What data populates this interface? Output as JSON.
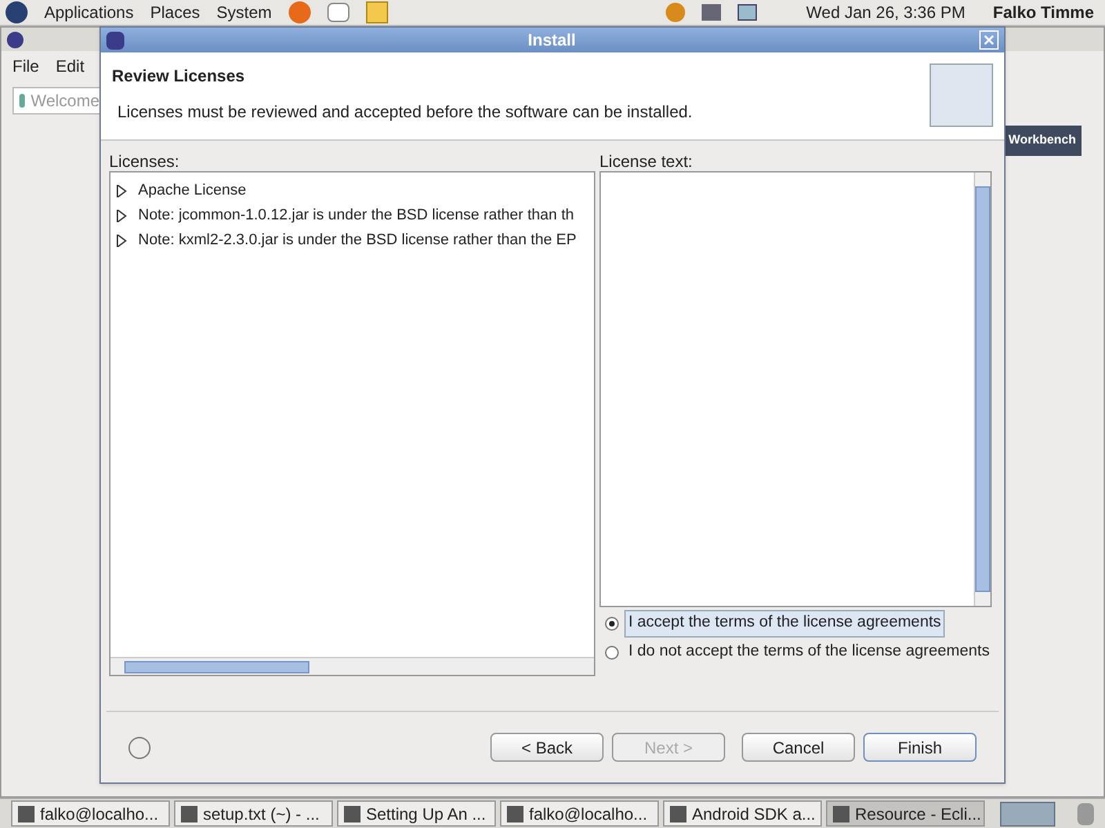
{
  "top_panel": {
    "menus": [
      "Applications",
      "Places",
      "System"
    ],
    "clock": "Wed Jan 26,  3:36 PM",
    "user": "Falko Timme"
  },
  "background_window": {
    "menus": [
      "File",
      "Edit"
    ],
    "tab": "Welcome",
    "workbench_label": "Workbench"
  },
  "dialog": {
    "title": "Install",
    "heading": "Review Licenses",
    "description": "Licenses must be reviewed and accepted before the software can be installed.",
    "licenses_label": "Licenses:",
    "license_text_label": "License text:",
    "licenses": [
      {
        "label": "Apache License",
        "expanded": false
      },
      {
        "label": "Note:  jcommon-1.0.12.jar is under the BSD license rather than th",
        "expanded": false
      },
      {
        "label": "Note:  kxml2-2.3.0.jar is under the BSD license rather than the EP",
        "expanded": false
      }
    ],
    "options": [
      {
        "label": "I accept the terms of the license agreements",
        "selected": true
      },
      {
        "label": "I do not accept the terms of the license agreements",
        "selected": false
      }
    ],
    "buttons": [
      {
        "label": "< Back",
        "disabled": false,
        "default": false
      },
      {
        "label": "Next >",
        "disabled": true,
        "default": false
      },
      {
        "label": "Cancel",
        "disabled": false,
        "default": false
      },
      {
        "label": "Finish",
        "disabled": false,
        "default": true
      }
    ]
  },
  "taskbar": [
    {
      "label": "falko@localho...",
      "selected": false
    },
    {
      "label": "setup.txt (~) - ...",
      "selected": false
    },
    {
      "label": "Setting Up An ...",
      "selected": false
    },
    {
      "label": "falko@localho...",
      "selected": false
    },
    {
      "label": "Android SDK a...",
      "selected": false
    },
    {
      "label": "Resource - Ecli...",
      "selected": true
    }
  ]
}
